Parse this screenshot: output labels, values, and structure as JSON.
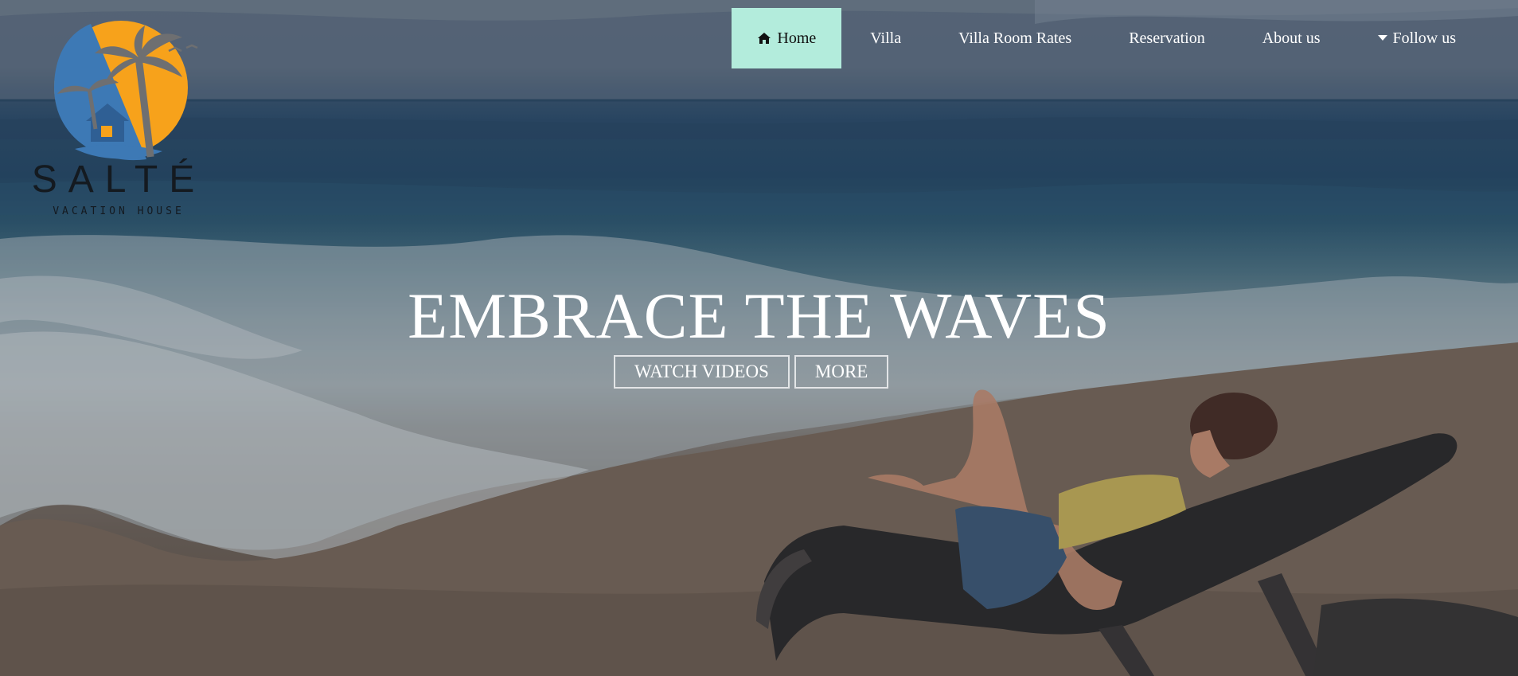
{
  "brand": {
    "name": "SALTÉ",
    "tagline": "VACATION HOUSE",
    "colors": {
      "sun": "#f7a21b",
      "sea": "#3d79b5",
      "palm": "#6e6f71"
    }
  },
  "nav": {
    "items": [
      {
        "label": "Home",
        "icon": "home-icon",
        "active": true
      },
      {
        "label": "Villa"
      },
      {
        "label": "Villa Room Rates"
      },
      {
        "label": "Reservation"
      },
      {
        "label": "About us"
      },
      {
        "label": "Follow us",
        "icon": "caret-down-icon"
      }
    ],
    "active_color": "#b3ecdc"
  },
  "hero": {
    "headline": "EMBRACE THE WAVES",
    "buttons": [
      {
        "label": "WATCH VIDEOS"
      },
      {
        "label": "MORE"
      }
    ]
  }
}
